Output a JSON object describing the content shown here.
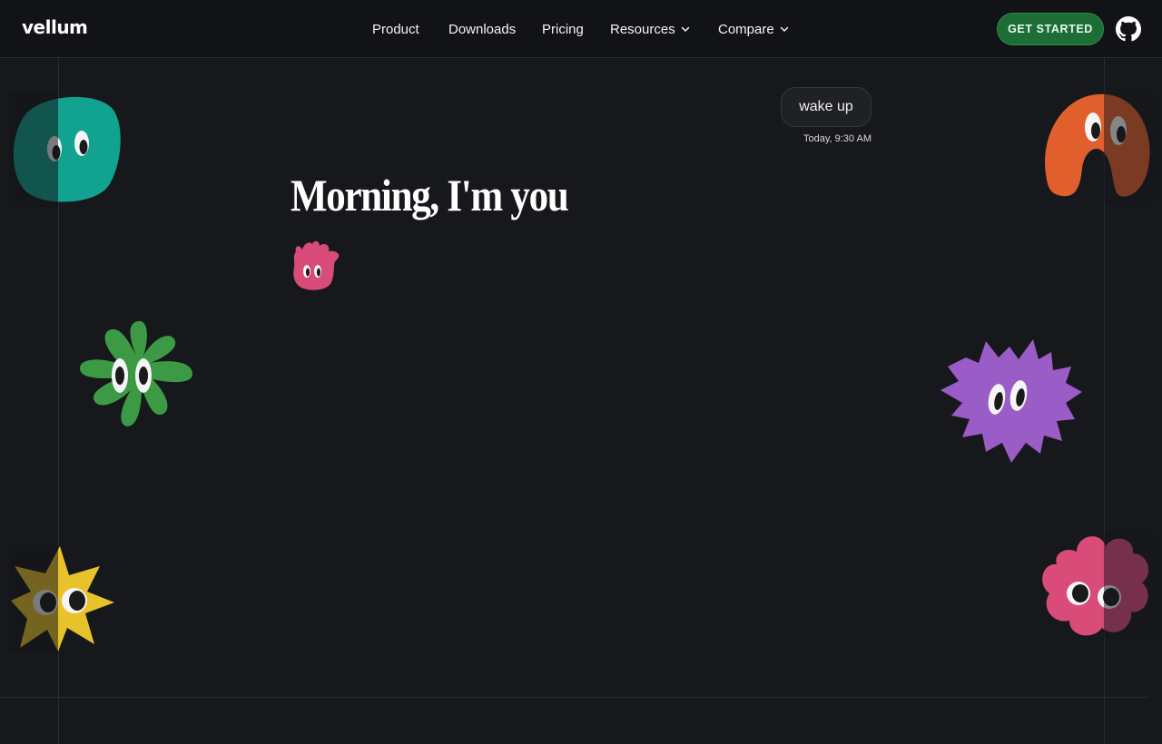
{
  "header": {
    "logo": "vellum",
    "nav": [
      {
        "label": "Product",
        "has_menu": false
      },
      {
        "label": "Downloads",
        "has_menu": false
      },
      {
        "label": "Pricing",
        "has_menu": false
      },
      {
        "label": "Resources",
        "has_menu": true
      },
      {
        "label": "Compare",
        "has_menu": true
      }
    ],
    "cta_label": "GET STARTED",
    "github_icon": "github-icon"
  },
  "message": {
    "text": "wake up",
    "timestamp": "Today, 9:30 AM"
  },
  "hero": {
    "headline": "Morning, I'm you"
  },
  "decor": {
    "icons": [
      "teal-blob-icon",
      "orange-arch-icon",
      "green-flower-icon",
      "purple-spiky-icon",
      "yellow-star-icon",
      "pink-flower-icon",
      "pink-hand-icon"
    ]
  },
  "colors": {
    "background": "#17181c",
    "header": "#121316",
    "cta": "#1c6e36",
    "teal": "#11a390",
    "orange": "#e05f2c",
    "green": "#3c9a44",
    "purple": "#9a5cc6",
    "yellow": "#e8c22a",
    "pink": "#d94b78"
  }
}
